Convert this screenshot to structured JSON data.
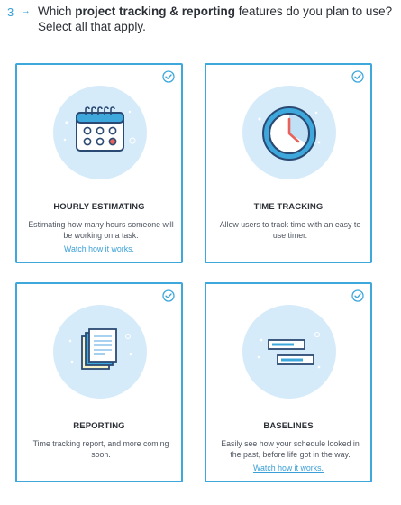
{
  "question": {
    "number": "3",
    "arrow": "→",
    "text_before": "Which ",
    "text_bold": "project tracking & reporting",
    "text_after": " features do you plan to use? Select all that apply."
  },
  "colors": {
    "accent": "#3ea8dc",
    "circle_bg": "#d6ebf9"
  },
  "cards": [
    {
      "title": "HOURLY ESTIMATING",
      "description": "Estimating how many hours someone will be working on a task.",
      "link": "Watch how it works.",
      "icon": "calendar-icon",
      "checked": true
    },
    {
      "title": "TIME TRACKING",
      "description": "Allow users to track time with an easy to use timer.",
      "icon": "clock-icon",
      "checked": true
    },
    {
      "title": "REPORTING",
      "description": "Time tracking report, and more coming soon.",
      "icon": "report-documents-icon",
      "checked": true
    },
    {
      "title": "BASELINES",
      "description": "Easily see how your schedule looked in the past, before life got in the way.",
      "link": "Watch how it works.",
      "icon": "gantt-bars-icon",
      "checked": true
    }
  ]
}
